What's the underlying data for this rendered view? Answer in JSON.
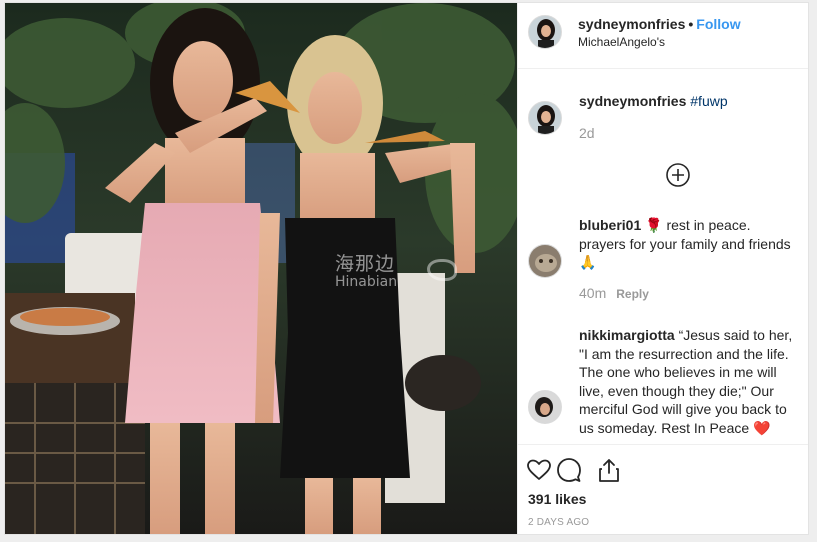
{
  "post": {
    "username": "sydneymonfries",
    "separator": "•",
    "follow_label": "Follow",
    "location": "MichaelAngelo's",
    "watermark": {
      "cn": "海那边",
      "en": "Hinabian"
    }
  },
  "caption": {
    "username": "sydneymonfries",
    "hashtag": "#fuwp",
    "time": "2d"
  },
  "comments": [
    {
      "username": "bluberi01",
      "text": "🌹 rest in peace. prayers for your family and friends 🙏",
      "time": "40m",
      "reply_label": "Reply"
    },
    {
      "username": "nikkimargiotta",
      "text": "“Jesus said to her, \"I am the resurrection and the life. The one who believes in me will live, even though they die;\" Our merciful God will give you back to us someday. Rest In Peace ❤️"
    }
  ],
  "footer": {
    "likes": "391 likes",
    "date": "2 DAYS AGO"
  },
  "icons": {
    "more_comments": "plus-circle-icon",
    "like": "heart-icon",
    "comment": "comment-icon",
    "share": "share-icon"
  },
  "colors": {
    "link_blue": "#3897f0",
    "hashtag": "#003569",
    "muted": "#999999"
  }
}
